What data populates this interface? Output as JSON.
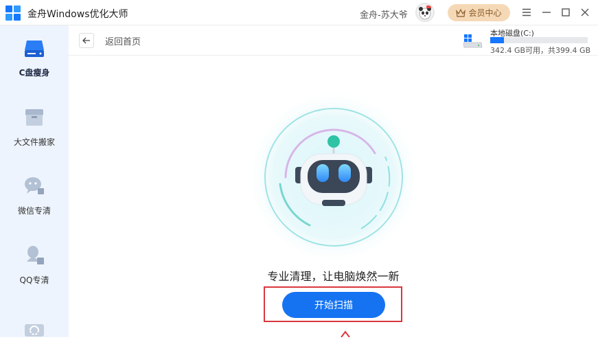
{
  "app": {
    "title": "金舟Windows优化大师",
    "user": "金舟-苏大爷",
    "vip_label": "会员中心"
  },
  "colors": {
    "accent": "#1573f2",
    "sidebar_bg": "#eef4fd",
    "vip_bg": "#f5d9b6",
    "highlight": "#d9363e"
  },
  "window_controls": [
    "menu-icon",
    "minimize-icon",
    "maximize-icon",
    "close-icon"
  ],
  "sidebar": {
    "items": [
      {
        "label": "C盘瘦身",
        "icon": "disk-icon",
        "active": true
      },
      {
        "label": "大文件搬家",
        "icon": "box-icon",
        "active": false
      },
      {
        "label": "微信专清",
        "icon": "wechat-icon",
        "active": false
      },
      {
        "label": "QQ专清",
        "icon": "qq-icon",
        "active": false
      },
      {
        "label": "",
        "icon": "refresh-icon",
        "active": false
      }
    ]
  },
  "subheader": {
    "back_label": "返回首页"
  },
  "disk": {
    "name": "本地磁盘(C:)",
    "info": "342.4 GB可用，共399.4 GB",
    "used_fraction": 0.143
  },
  "main": {
    "slogan": "专业清理，让电脑焕然一新",
    "scan_button": "开始扫描"
  }
}
